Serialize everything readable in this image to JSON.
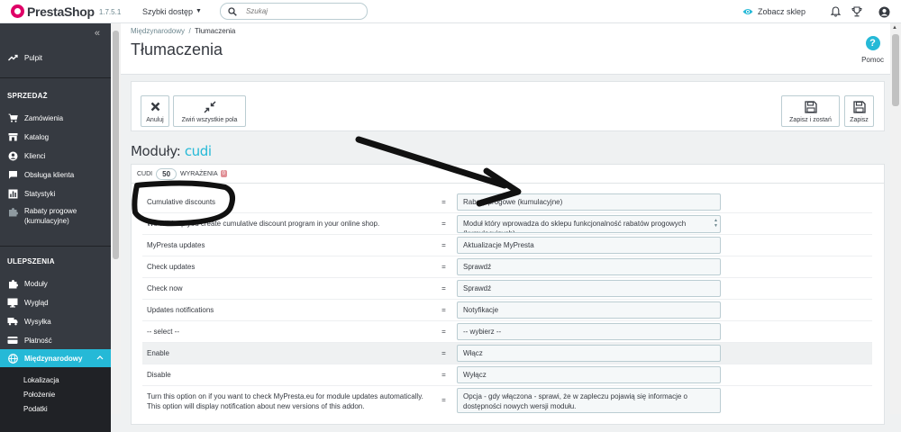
{
  "header": {
    "logo_text": "PrestaShop",
    "version": "1.7.5.1",
    "quick_access": "Szybki dostęp",
    "search_placeholder": "Szukaj",
    "view_shop": "Zobacz sklep"
  },
  "sidebar": {
    "collapse": "«",
    "dashboard": "Pulpit",
    "section_sales": "SPRZEDAŻ",
    "sales_items": [
      "Zamówienia",
      "Katalog",
      "Klienci",
      "Obsługa klienta",
      "Statystyki"
    ],
    "custom_item_line1": "Rabaty progowe",
    "custom_item_line2": "(kumulacyjne)",
    "section_improve": "ULEPSZENIA",
    "improve_items": [
      "Moduły",
      "Wygląd",
      "Wysyłka",
      "Płatność"
    ],
    "active_item": "Międzynarodowy",
    "sub_items": [
      "Lokalizacja",
      "Położenie",
      "Podatki"
    ]
  },
  "page": {
    "breadcrumb_parent": "Międzynarodowy",
    "breadcrumb_sep": "/",
    "breadcrumb_current": "Tłumaczenia",
    "title": "Tłumaczenia",
    "help_icon": "?",
    "help_label": "Pomoc"
  },
  "toolbar": {
    "cancel": "Anuluj",
    "collapse_all": "Zwiń wszystkie pola",
    "save_stay": "Zapisz i zostań",
    "save": "Zapisz"
  },
  "module": {
    "label": "Moduły:",
    "name": "cudi",
    "tab_name": "CUDI",
    "count": "50",
    "expressions_label": "WYRAŻENIA",
    "expressions_badge": "0"
  },
  "rows": [
    {
      "src": "Cumulative discounts",
      "eq": "=",
      "tr": "Rabaty progowe (kumulacyjne)"
    },
    {
      "src": "We will help you create cumulative discount program in your online shop.",
      "eq": "=",
      "tr": "Moduł który wprowadza do sklepu funkcjonalność rabatów progowych (kumulacyjnych)"
    },
    {
      "src": "MyPresta updates",
      "eq": "=",
      "tr": "Aktualizacje MyPresta"
    },
    {
      "src": "Check updates",
      "eq": "=",
      "tr": "Sprawdź"
    },
    {
      "src": "Check now",
      "eq": "=",
      "tr": "Sprawdź"
    },
    {
      "src": "Updates notifications",
      "eq": "=",
      "tr": "Notyfikacje"
    },
    {
      "src": "-- select --",
      "eq": "=",
      "tr": "-- wybierz --"
    },
    {
      "src": "Enable",
      "eq": "=",
      "tr": "Włącz"
    },
    {
      "src": "Disable",
      "eq": "=",
      "tr": "Wyłącz"
    },
    {
      "src": "Turn this option on if you want to check MyPresta.eu for module updates automatically. This option will display notification about new versions of this addon.",
      "eq": "=",
      "tr": "Opcja - gdy włączona - sprawi, że w zapleczu pojawią się informacje o dostępności nowych wersji modułu."
    }
  ],
  "colors": {
    "accent": "#25b9d7",
    "sidebar_bg": "#363a41",
    "brand": "#df0067"
  }
}
